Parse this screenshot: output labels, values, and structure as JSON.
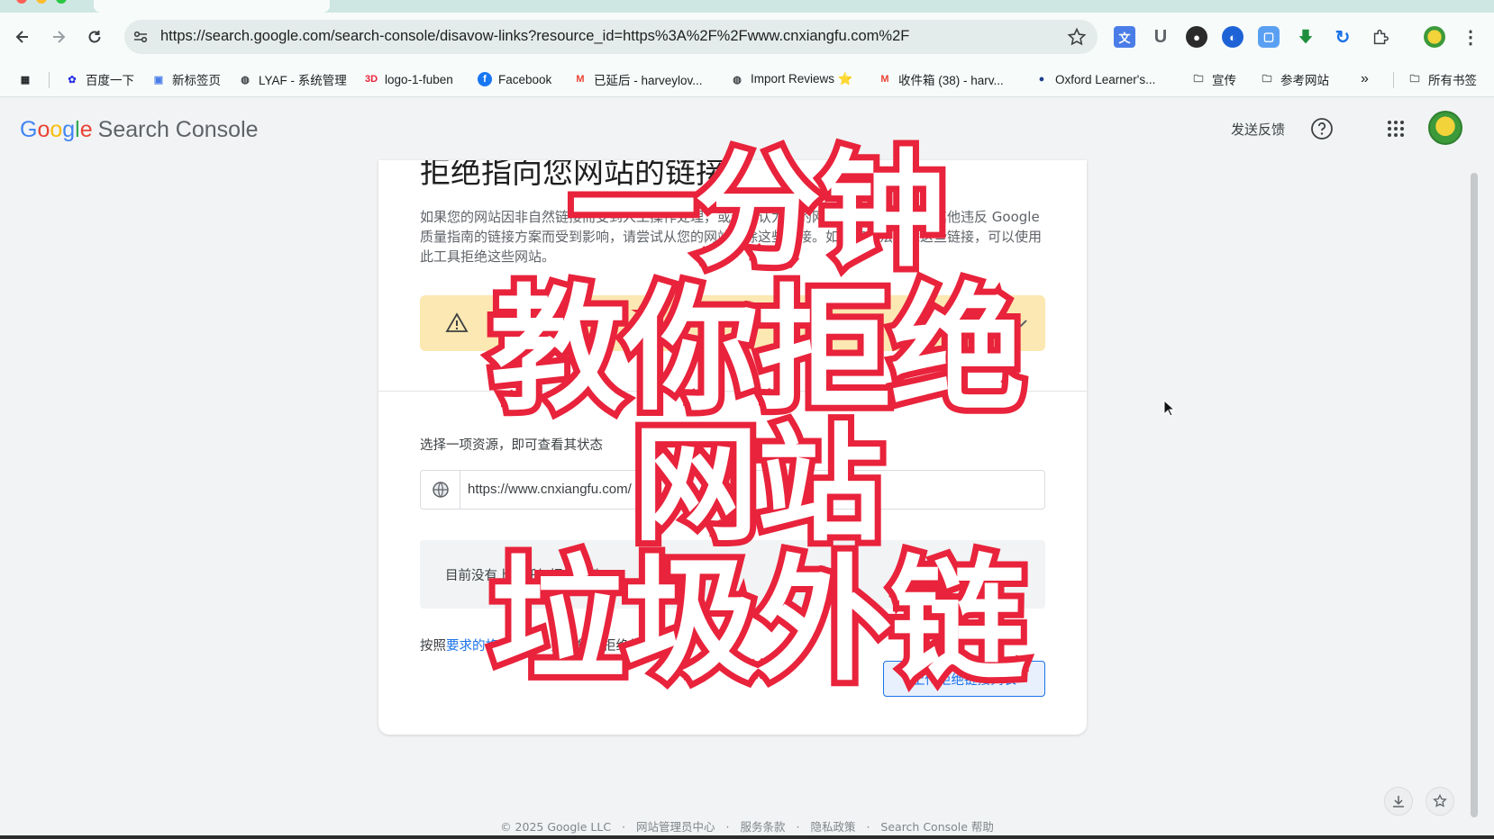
{
  "browser": {
    "url": "https://search.google.com/search-console/disavow-links?resource_id=https%3A%2F%2Fwww.cnxiangfu.com%2F",
    "bookmarks": [
      {
        "label": "百度一下"
      },
      {
        "label": "新标签页"
      },
      {
        "label": "LYAF - 系统管理"
      },
      {
        "label": "logo-1-fuben"
      },
      {
        "label": "Facebook"
      },
      {
        "label": "已延后 - harveylov..."
      },
      {
        "label": "Import Reviews ⭐"
      },
      {
        "label": "收件箱 (38) - harv..."
      },
      {
        "label": "Oxford Learner's..."
      },
      {
        "label": "宣传"
      },
      {
        "label": "参考网站"
      },
      {
        "label": "»"
      },
      {
        "label": "所有书签"
      }
    ]
  },
  "header": {
    "logo": {
      "g1": "G",
      "o1": "o",
      "o2": "o",
      "g2": "g",
      "l": "l",
      "e": "e"
    },
    "product": "Search Console",
    "feedback": "发送反馈"
  },
  "card": {
    "title": "拒绝指向您网站的链接",
    "description": "如果您的网站因非自然链接而受到人工操作处理，或者您认为您的网站包含付费链接或其他违反 Google 质量指南的链接方案而受到影响，请尝试从您的网站移除这些链接。如果您无法移除这些链接，可以使用此工具拒绝这些网站。",
    "select_label": "选择一项资源，即可查看其状态",
    "resource_url": "https://www.cnxiangfu.com/",
    "empty_text": "目前没有上传任何拒绝文件",
    "footer_text_prefix": "按照",
    "footer_link": "要求的格式",
    "footer_text_suffix": "，其中列出您要拒绝的链接",
    "upload_button": "上传拒绝链接列表"
  },
  "footer": {
    "copyright": "© 2025 Google LLC",
    "links": [
      "网站管理员中心",
      "服务条款",
      "隐私政策",
      "Search Console 帮助"
    ],
    "separator": "·"
  },
  "overlay": {
    "line1": "一分钟",
    "line2": "教你拒绝",
    "line3": "网站",
    "line4": "垃圾外链"
  },
  "colors": {
    "overlay_stroke": "#e8233b",
    "overlay_fill": "#ffffff",
    "warning_bg": "#fce8b2",
    "link": "#1a73e8"
  }
}
